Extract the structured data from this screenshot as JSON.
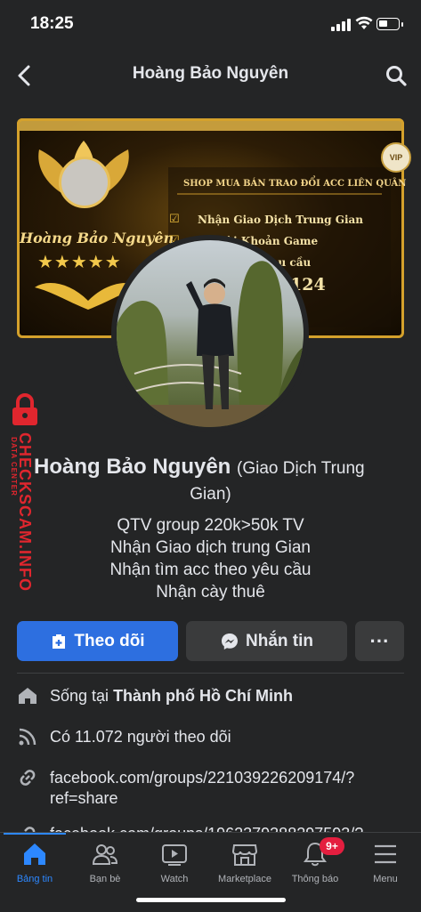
{
  "status": {
    "time": "18:25"
  },
  "header": {
    "title": "Hoàng Bảo Nguyên"
  },
  "cover": {
    "name": "Hoàng Bảo Nguyên",
    "stars": "★★★★★",
    "shop_title": "SHOP MUA BÁN TRAO ĐỔI ACC LIÊN QUÂN",
    "lines": [
      "Nhận Giao Dịch Trung Gian",
      "...c Tài Khoản Game",
      "...u cầu"
    ],
    "number": "124",
    "badge": "VIP"
  },
  "profile": {
    "name": "Hoàng Bảo Nguyên",
    "alt_name": "(Giao Dịch Trung",
    "alt_name_cont": "Gian)",
    "bio": [
      "QTV group  220k>50k TV",
      "Nhận Giao dịch trung Gian",
      "Nhận tìm acc theo yêu cầu",
      "Nhận cày thuê"
    ]
  },
  "actions": {
    "follow": "Theo dõi",
    "message": "Nhắn tin",
    "more": "···"
  },
  "info": {
    "lives_prefix": "Sống tại ",
    "lives_city": "Thành phố Hồ Chí Minh",
    "followers": "Có 11.072 người theo dõi",
    "link_line1": "facebook.com/groups/221039226209174/?",
    "link_line2": "ref=share",
    "link2_partial": "facebook.com/groups/1962379388297593/?"
  },
  "watermark": {
    "text": "CHECKSCAM.INFO",
    "sub": "DATA CENTER"
  },
  "tabs": [
    {
      "label": "Bảng tin",
      "icon": "home-icon",
      "active": true
    },
    {
      "label": "Bạn bè",
      "icon": "friends-icon"
    },
    {
      "label": "Watch",
      "icon": "watch-icon"
    },
    {
      "label": "Marketplace",
      "icon": "marketplace-icon"
    },
    {
      "label": "Thông báo",
      "icon": "bell-icon",
      "badge": "9+"
    },
    {
      "label": "Menu",
      "icon": "menu-icon"
    }
  ],
  "colors": {
    "accent": "#2d6fe0",
    "background": "#242526",
    "badge": "#e41e3f",
    "watermark": "#e0262e"
  }
}
